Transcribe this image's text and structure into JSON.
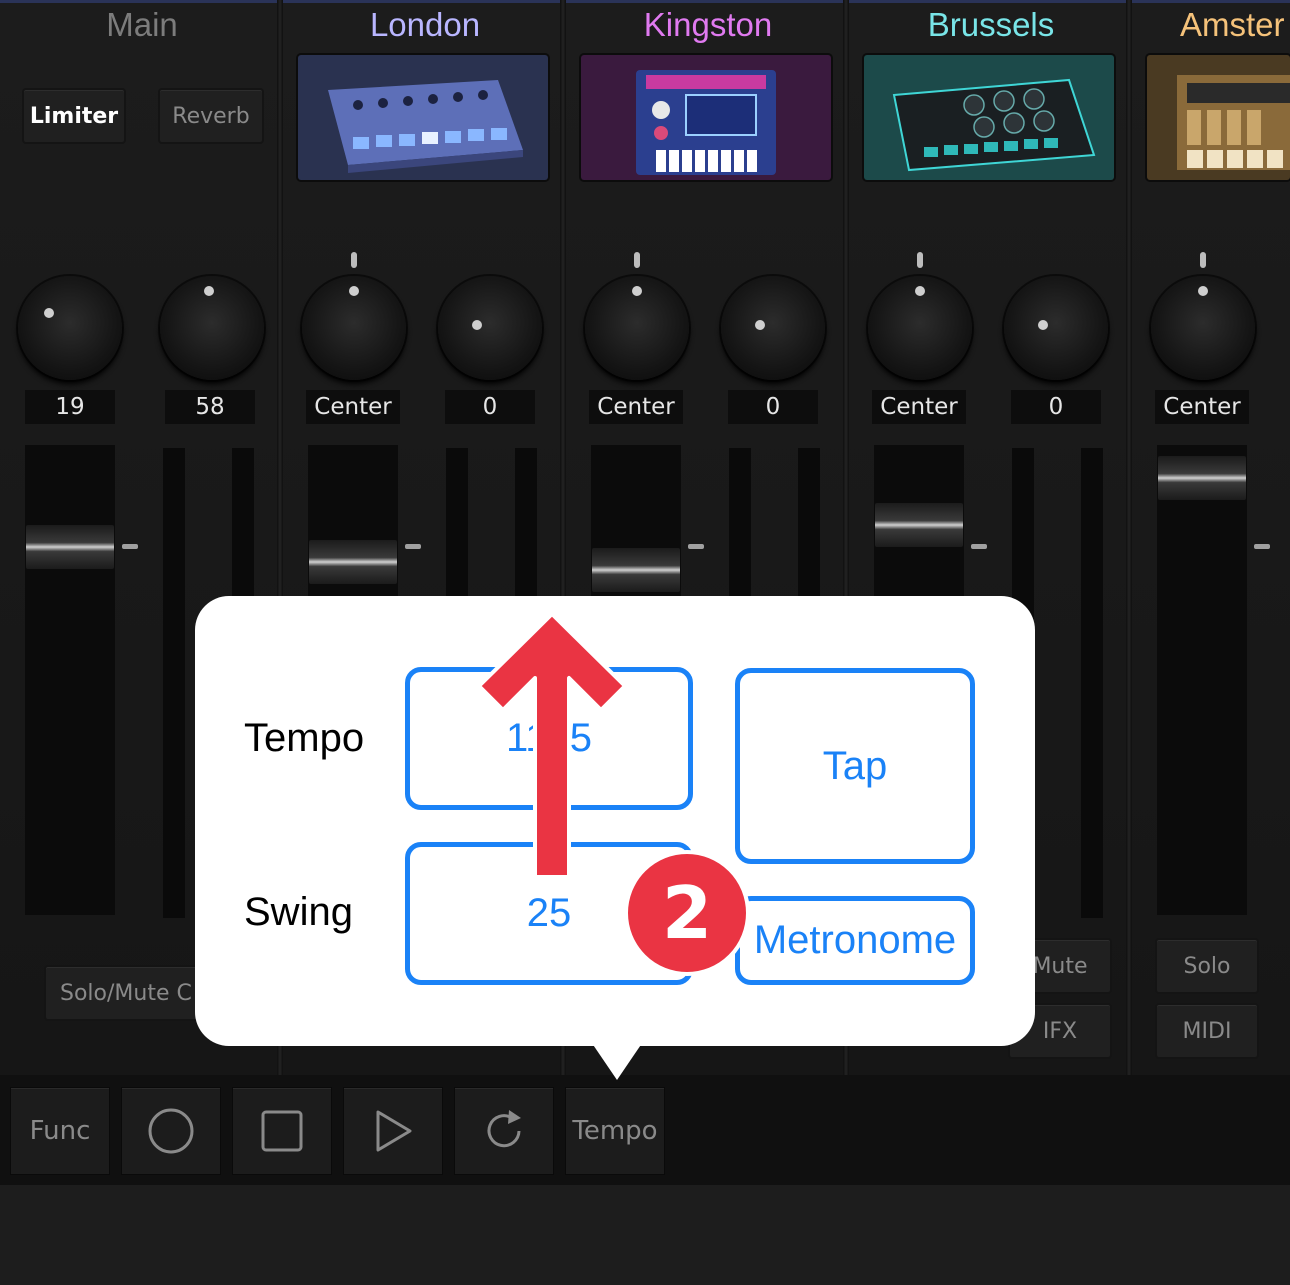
{
  "channels": [
    {
      "title": "Main",
      "color": "#7c7c7c"
    },
    {
      "title": "London",
      "color": "#b9b6ff"
    },
    {
      "title": "Kingston",
      "color": "#e07af0"
    },
    {
      "title": "Brussels",
      "color": "#79e5e8"
    },
    {
      "title": "Amster",
      "color": "#f5c27a"
    }
  ],
  "main": {
    "limiter_label": "Limiter",
    "reverb_label": "Reverb",
    "knob_values": [
      "19",
      "58"
    ],
    "solo_mute_label": "Solo/Mute C"
  },
  "london": {
    "pan": "Center",
    "send": "0"
  },
  "kingston": {
    "pan": "Center",
    "send": "0"
  },
  "brussels": {
    "pan": "Center",
    "send": "0",
    "mute_label": "Mute",
    "ifx_label": "IFX"
  },
  "amster": {
    "pan": "Center",
    "solo_label": "Solo",
    "midi_label": "MIDI"
  },
  "toolbar": {
    "func_label": "Func",
    "tempo_label": "Tempo",
    "icons": [
      "record-icon",
      "stop-icon",
      "play-icon",
      "loop-icon"
    ]
  },
  "popover": {
    "tempo_label": "Tempo",
    "tempo_value": "11 .5",
    "swing_label": "Swing",
    "swing_value": "25",
    "tap_label": "Tap",
    "metronome_label": "Metronome"
  },
  "annotation": {
    "step_number": "2",
    "color": "#ea3443"
  }
}
